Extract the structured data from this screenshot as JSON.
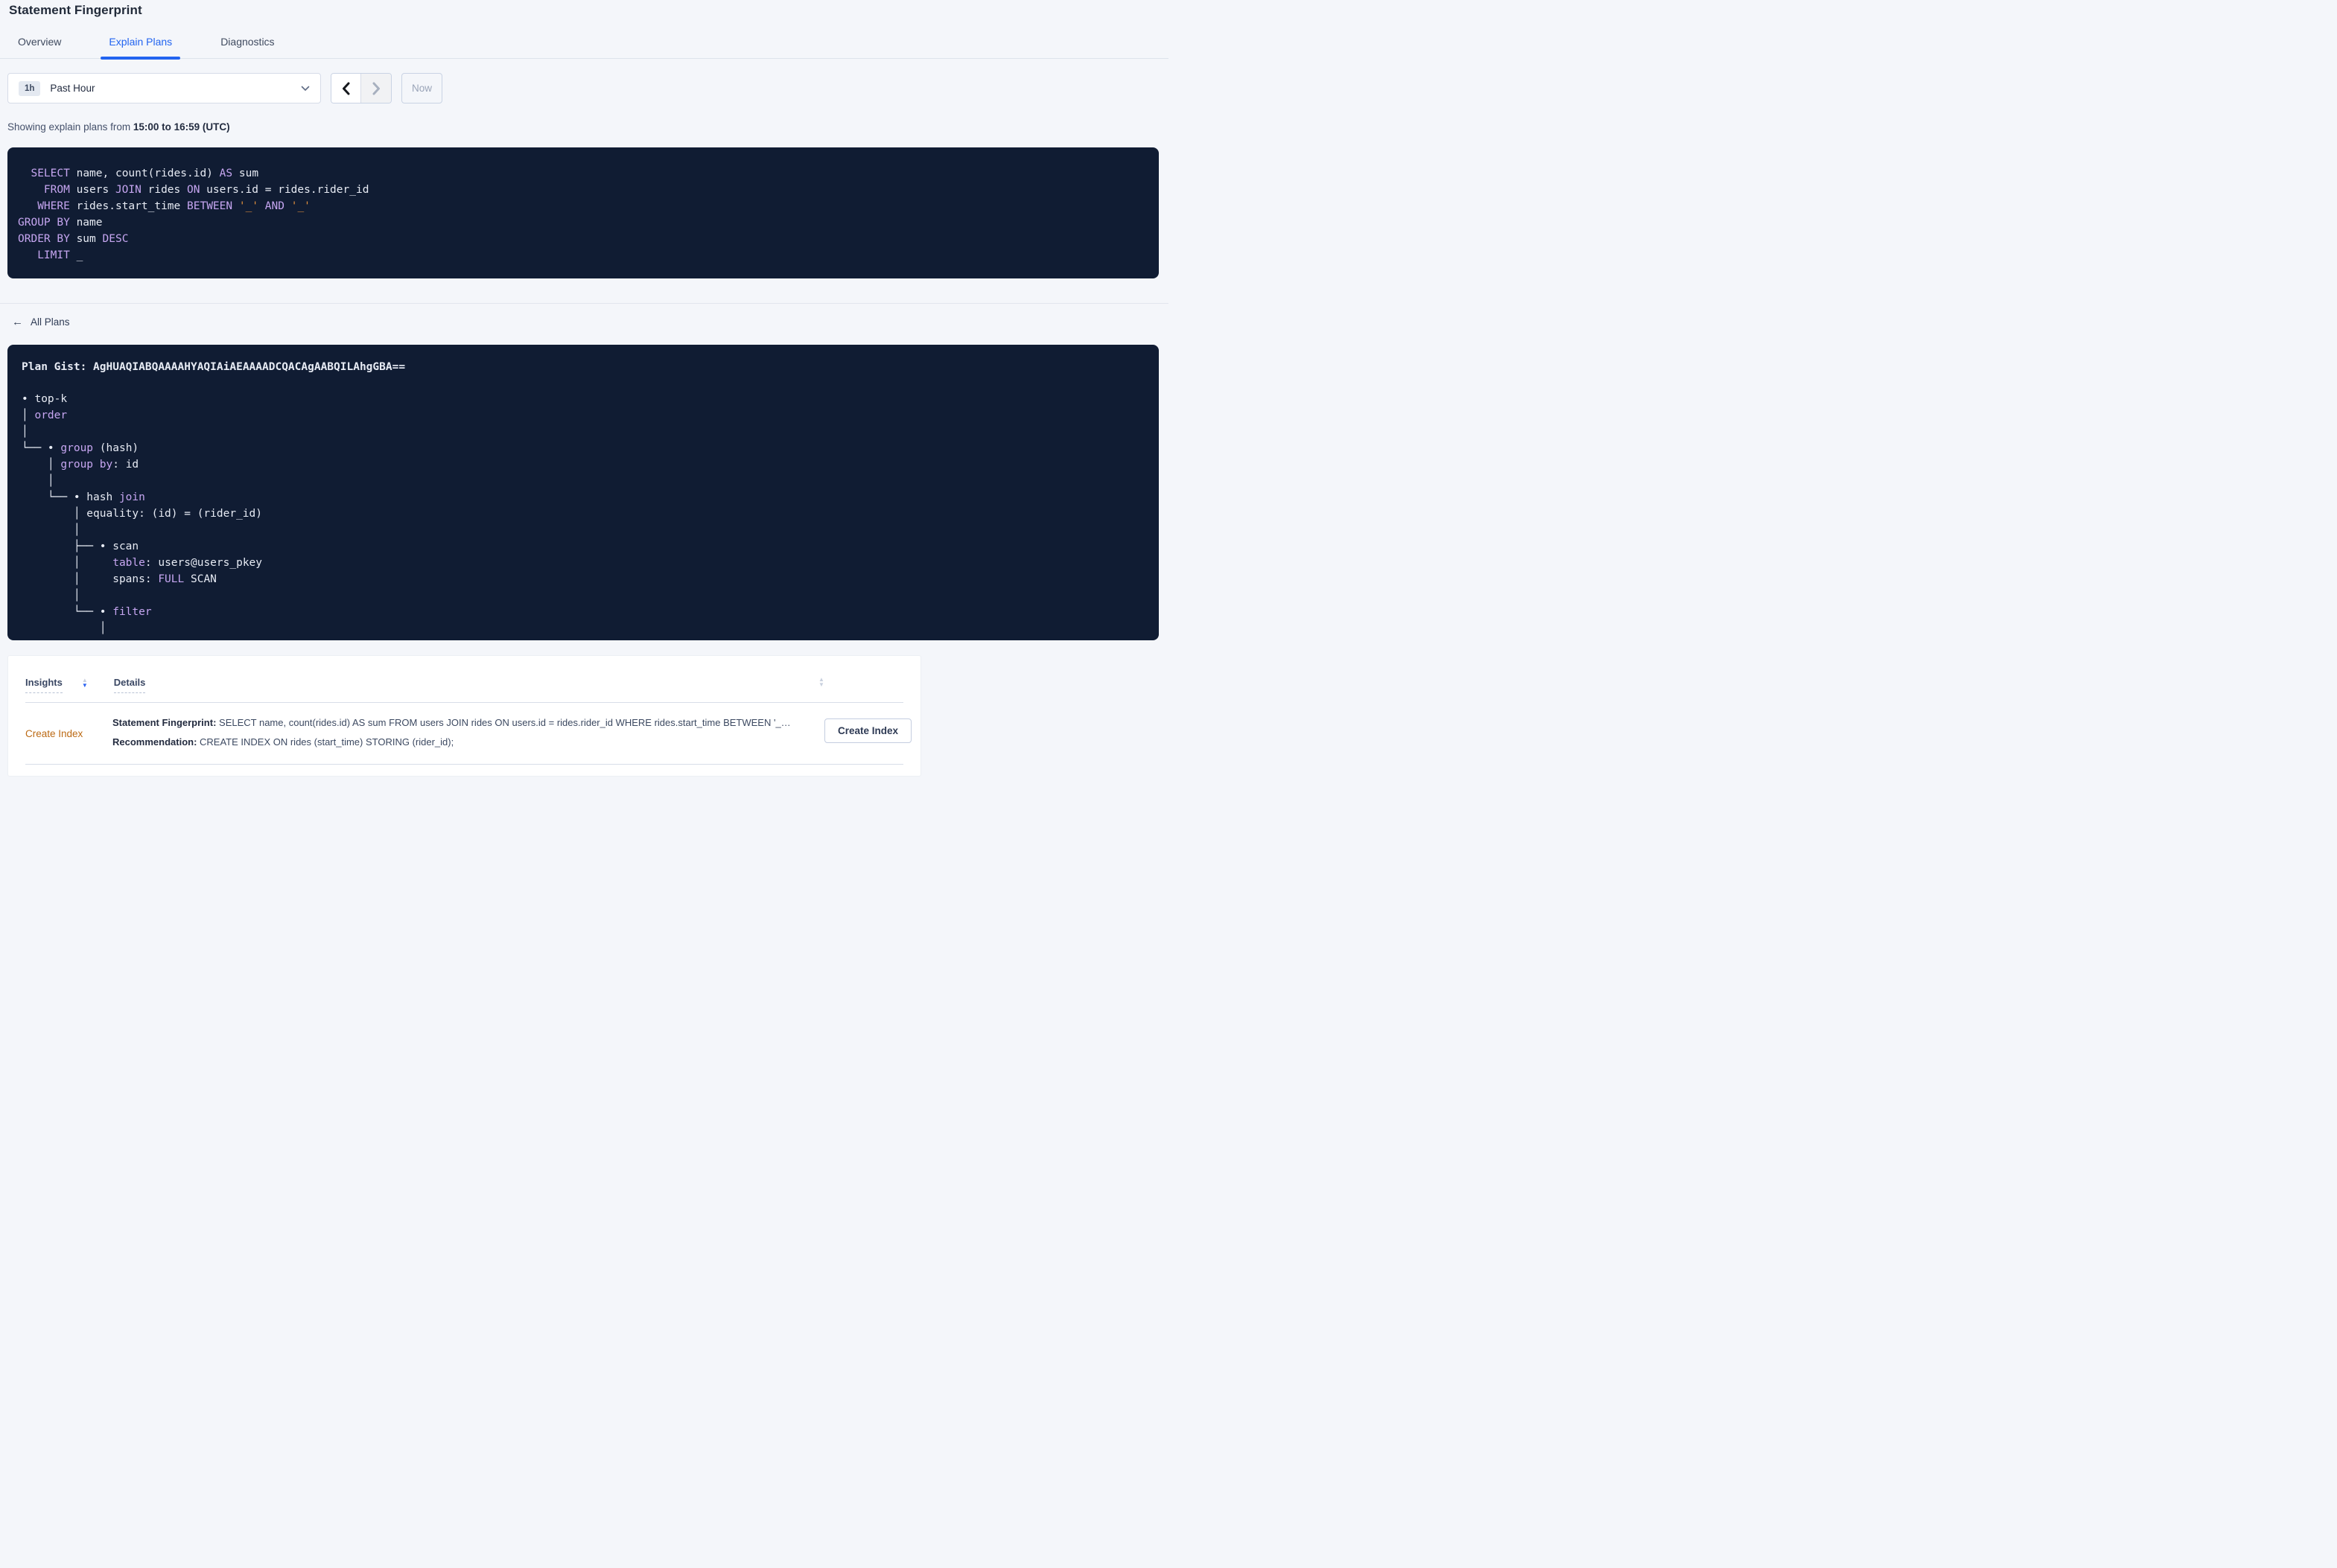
{
  "page": {
    "title": "Statement Fingerprint"
  },
  "tabs": [
    {
      "label": "Overview",
      "active": false
    },
    {
      "label": "Explain Plans",
      "active": true
    },
    {
      "label": "Diagnostics",
      "active": false
    }
  ],
  "time_picker": {
    "badge": "1h",
    "label": "Past Hour",
    "now_label": "Now"
  },
  "status_line": {
    "prefix": "Showing explain plans from ",
    "bold": "15:00 to 16:59 (UTC)"
  },
  "colors": {
    "accent_blue": "#2264f0",
    "keyword_purple": "#c6a6f1",
    "literal_orange": "#e3913c",
    "insight_link_orange": "#bc6a14",
    "code_background": "#101c33",
    "sort_active_blue": "#2b63f2"
  },
  "sql": {
    "lines": [
      [
        {
          "t": "  "
        },
        {
          "t": "SELECT",
          "c": "kw"
        },
        {
          "t": " name, count(rides.id) "
        },
        {
          "t": "AS",
          "c": "kw"
        },
        {
          "t": " sum"
        }
      ],
      [
        {
          "t": "    "
        },
        {
          "t": "FROM",
          "c": "kw"
        },
        {
          "t": " users "
        },
        {
          "t": "JOIN",
          "c": "kw"
        },
        {
          "t": " rides "
        },
        {
          "t": "ON",
          "c": "kw"
        },
        {
          "t": " users.id = rides.rider_id"
        }
      ],
      [
        {
          "t": "   "
        },
        {
          "t": "WHERE",
          "c": "kw"
        },
        {
          "t": " rides.start_time "
        },
        {
          "t": "BETWEEN",
          "c": "kw"
        },
        {
          "t": " "
        },
        {
          "t": "'_'",
          "c": "str"
        },
        {
          "t": " "
        },
        {
          "t": "AND",
          "c": "kw"
        },
        {
          "t": " "
        },
        {
          "t": "'_'",
          "c": "str"
        }
      ],
      [
        {
          "t": "GROUP BY",
          "c": "kw"
        },
        {
          "t": " name"
        }
      ],
      [
        {
          "t": "ORDER BY",
          "c": "kw"
        },
        {
          "t": " sum "
        },
        {
          "t": "DESC",
          "c": "kw"
        }
      ],
      [
        {
          "t": "   "
        },
        {
          "t": "LIMIT",
          "c": "kw"
        },
        {
          "t": " _"
        }
      ]
    ]
  },
  "all_plans_link": {
    "label": "All Plans"
  },
  "plan": {
    "gist_label": "Plan Gist: ",
    "gist": "AgHUAQIABQAAAAHYAQIAiAEAAAADCQACAgAABQILAhgGBA==",
    "tree": [
      [
        {
          "t": "• top-k"
        }
      ],
      [
        {
          "t": "│ "
        },
        {
          "t": "order",
          "c": "kw"
        }
      ],
      [
        {
          "t": "│"
        }
      ],
      [
        {
          "t": "└── • "
        },
        {
          "t": "group",
          "c": "kw"
        },
        {
          "t": " (hash)"
        }
      ],
      [
        {
          "t": "    │ "
        },
        {
          "t": "group by",
          "c": "kw"
        },
        {
          "t": ": id"
        }
      ],
      [
        {
          "t": "    │"
        }
      ],
      [
        {
          "t": "    └── • hash "
        },
        {
          "t": "join",
          "c": "kw"
        }
      ],
      [
        {
          "t": "        │ equality: (id) = (rider_id)"
        }
      ],
      [
        {
          "t": "        │"
        }
      ],
      [
        {
          "t": "        ├── • scan"
        }
      ],
      [
        {
          "t": "        │     "
        },
        {
          "t": "table",
          "c": "kw"
        },
        {
          "t": ": users@users_pkey"
        }
      ],
      [
        {
          "t": "        │     spans: "
        },
        {
          "t": "FULL",
          "c": "kw"
        },
        {
          "t": " SCAN"
        }
      ],
      [
        {
          "t": "        │"
        }
      ],
      [
        {
          "t": "        └── • "
        },
        {
          "t": "filter",
          "c": "kw"
        }
      ],
      [
        {
          "t": "            │"
        }
      ]
    ]
  },
  "insights_table": {
    "col_insights": "Insights",
    "col_details": "Details",
    "row": {
      "insight_link": "Create Index",
      "detail_1_label": "Statement Fingerprint:",
      "detail_1_text": " SELECT name, count(rides.id) AS sum FROM users JOIN rides ON users.id = rides.rider_id WHERE rides.start_time BETWEEN '_…",
      "detail_2_label": "Recommendation:",
      "detail_2_text": " CREATE INDEX ON rides (start_time) STORING (rider_id);",
      "action_button": "Create Index"
    }
  }
}
